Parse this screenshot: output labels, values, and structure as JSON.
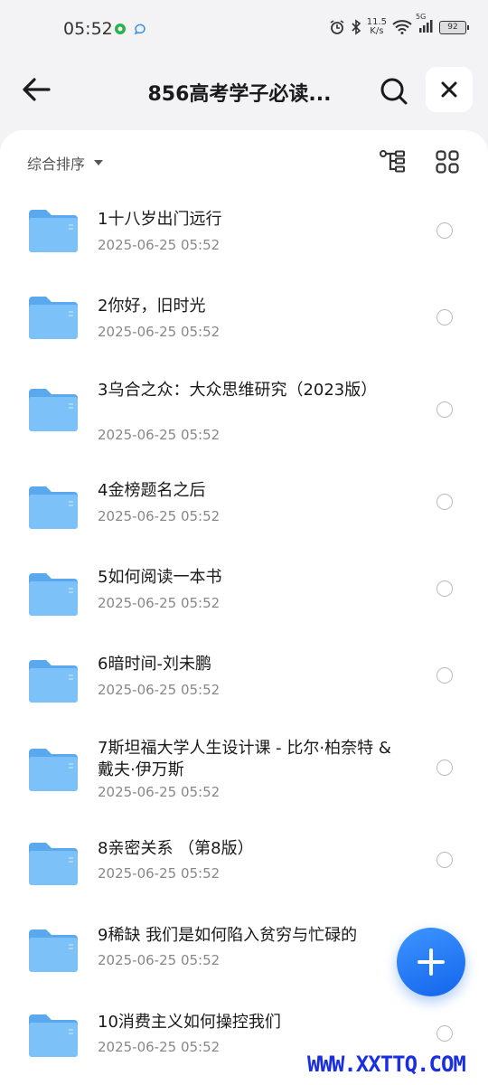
{
  "status_bar": {
    "time": "05:52",
    "net_speed_value": "11.5",
    "net_speed_unit": "K/s",
    "signal_label": "5G",
    "battery": "92"
  },
  "header": {
    "title": "856高考学子必读...",
    "back_icon": "arrow-left-icon",
    "search_icon": "search-icon",
    "close_icon": "close-icon"
  },
  "toolbar": {
    "sort_label": "综合排序",
    "tree_icon": "tree-structure-icon",
    "grid_icon": "grid-view-icon"
  },
  "files": [
    {
      "name": "1十八岁出门远行",
      "date": "2025-06-25 05:52"
    },
    {
      "name": "2你好，旧时光",
      "date": "2025-06-25 05:52"
    },
    {
      "name": "3乌合之众：大众思维研究（2023版）",
      "date": "2025-06-25 05:52"
    },
    {
      "name": "4金榜题名之后",
      "date": "2025-06-25 05:52"
    },
    {
      "name": "5如何阅读一本书",
      "date": "2025-06-25 05:52"
    },
    {
      "name": "6暗时间-刘未鹏",
      "date": "2025-06-25 05:52"
    },
    {
      "name": "7斯坦福大学人生设计课 - 比尔·柏奈特 & 戴夫·伊万斯",
      "date": "2025-06-25 05:52"
    },
    {
      "name": "8亲密关系 （第8版）",
      "date": "2025-06-25 05:52"
    },
    {
      "name": "9稀缺 我们是如何陷入贫穷与忙碌的",
      "date": "2025-06-25 05:52"
    },
    {
      "name": "10消费主义如何操控我们",
      "date": "2025-06-25 05:52"
    }
  ],
  "fab_icon": "plus-icon",
  "watermark": "WWW.XXTTQ.COM",
  "colors": {
    "accent": "#1d6ff2",
    "folder": "#6bb8f5",
    "watermark": "#1a2fe0"
  }
}
